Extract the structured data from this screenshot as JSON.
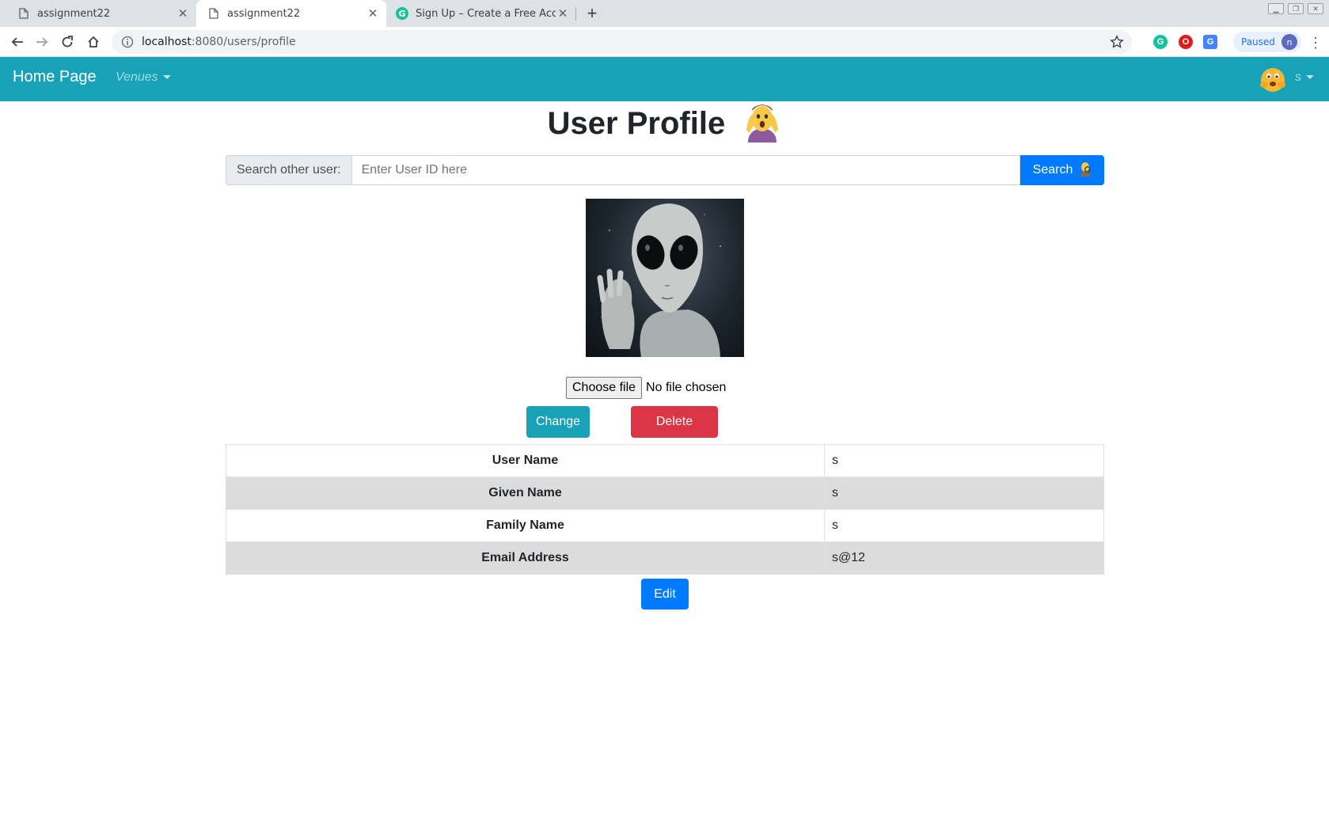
{
  "browser": {
    "tabs": [
      {
        "title": "assignment22",
        "active": false
      },
      {
        "title": "assignment22",
        "active": true
      },
      {
        "title": "Sign Up – Create a Free Accoun",
        "active": false
      }
    ],
    "new_tab_label": "+",
    "url": {
      "host": "localhost",
      "path": ":8080/users/profile"
    },
    "profile_status": "Paused",
    "profile_initial": "n",
    "extensions": [
      "grammarly-icon",
      "opera-vpn-icon",
      "google-translate-icon"
    ]
  },
  "navbar": {
    "brand": "Home Page",
    "venues_label": "Venues",
    "user_label": "s",
    "color": "#17a2b8"
  },
  "page": {
    "title": "User Profile",
    "search": {
      "label": "Search other user:",
      "placeholder": "Enter User ID here",
      "button_label": "Search"
    },
    "file_input": {
      "button_label": "Choose file",
      "status": "No file chosen"
    },
    "change_label": "Change",
    "delete_label": "Delete",
    "profile_rows": [
      {
        "key": "User Name",
        "value": "s"
      },
      {
        "key": "Given Name",
        "value": "s"
      },
      {
        "key": "Family Name",
        "value": "s"
      },
      {
        "key": "Email Address",
        "value": "s@12"
      }
    ],
    "edit_label": "Edit"
  },
  "colors": {
    "primary": "#007bff",
    "info": "#17a2b8",
    "danger": "#dc3545",
    "stripe": "#dcdcdc"
  }
}
